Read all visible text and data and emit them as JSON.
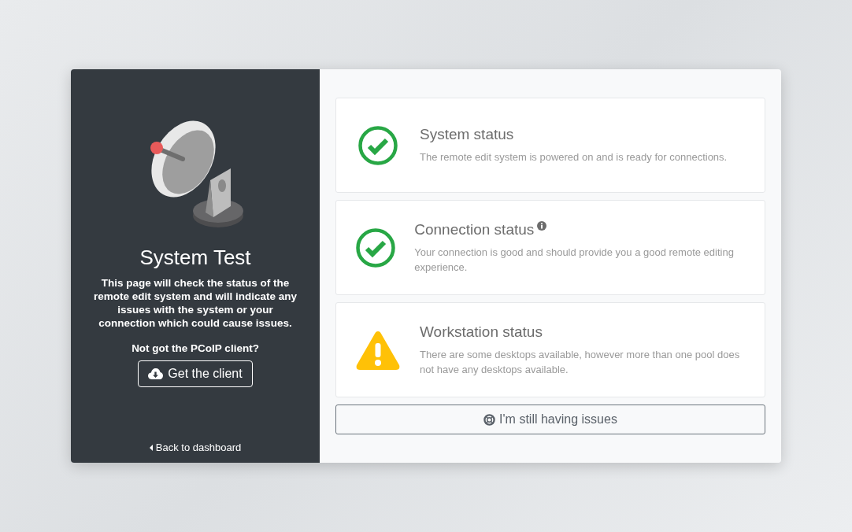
{
  "sidebar": {
    "title": "System Test",
    "description": "This page will check the status of the remote edit system and will indicate any issues with the system or your connection which could cause issues.",
    "client_prompt": "Not got the PCoIP client?",
    "client_button": "Get the client",
    "back_link": "Back to dashboard"
  },
  "statuses": [
    {
      "kind": "ok",
      "title": "System status",
      "info": false,
      "text": "The remote edit system is powered on and is ready for connections."
    },
    {
      "kind": "ok",
      "title": "Connection status",
      "info": true,
      "text": "Your connection is good and should provide you a good remote editing experience."
    },
    {
      "kind": "warning",
      "title": "Workstation status",
      "info": false,
      "text": "There are some desktops available, however more than one pool does not have any desktops available."
    }
  ],
  "help_button": "I'm still having issues"
}
